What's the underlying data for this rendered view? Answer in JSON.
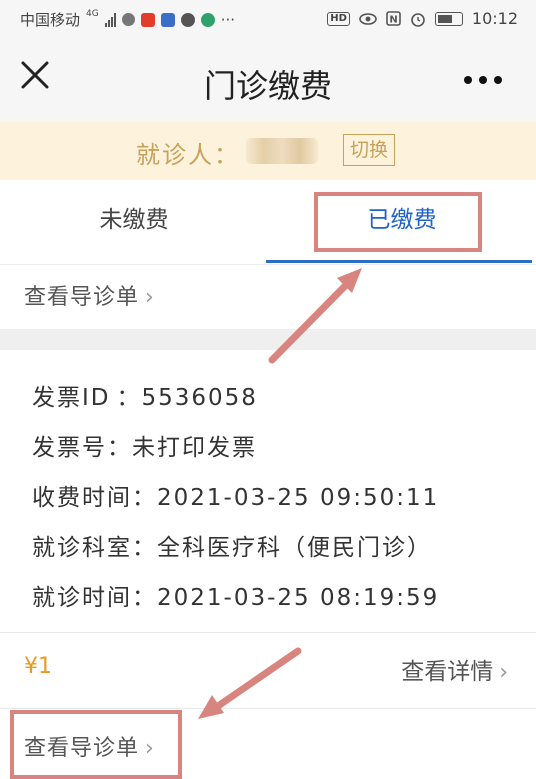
{
  "status_bar": {
    "carrier": "中国移动",
    "network": "4G",
    "hd": "HD",
    "time": "10:12",
    "icons": [
      "signal-icon",
      "notification-icon",
      "app-icon",
      "chat-icon",
      "eye-icon",
      "nfc-icon",
      "alarm-icon",
      "battery-icon"
    ]
  },
  "header": {
    "title": "门诊缴费",
    "close_icon": "close-icon",
    "more_icon": "more-icon"
  },
  "patient": {
    "label": "就诊人：",
    "switch_label": "切换"
  },
  "tabs": [
    {
      "label": "未缴费"
    },
    {
      "label": "已缴费",
      "active": true
    }
  ],
  "guide": {
    "label": "查看导诊单",
    "chevron": "›"
  },
  "record": {
    "rows": [
      {
        "label": "发票ID",
        "sep": "：",
        "value": "5536058"
      },
      {
        "label": "发票号",
        "sep": "：",
        "value": "未打印发票"
      },
      {
        "label": "收费时间",
        "sep": "：",
        "value": "2021-03-25 09:50:11"
      },
      {
        "label": "就诊科室",
        "sep": "：",
        "value": "全科医疗科（便民门诊）"
      },
      {
        "label": "就诊时间",
        "sep": "：",
        "value": "2021-03-25 08:19:59"
      }
    ],
    "amount": "¥1",
    "detail_label": "查看详情",
    "guide_label": "查看导诊单"
  },
  "colors": {
    "accent": "#1e63c5",
    "gold": "#c8a15a",
    "amount": "#e69a25",
    "highlight": "#d9857f"
  }
}
